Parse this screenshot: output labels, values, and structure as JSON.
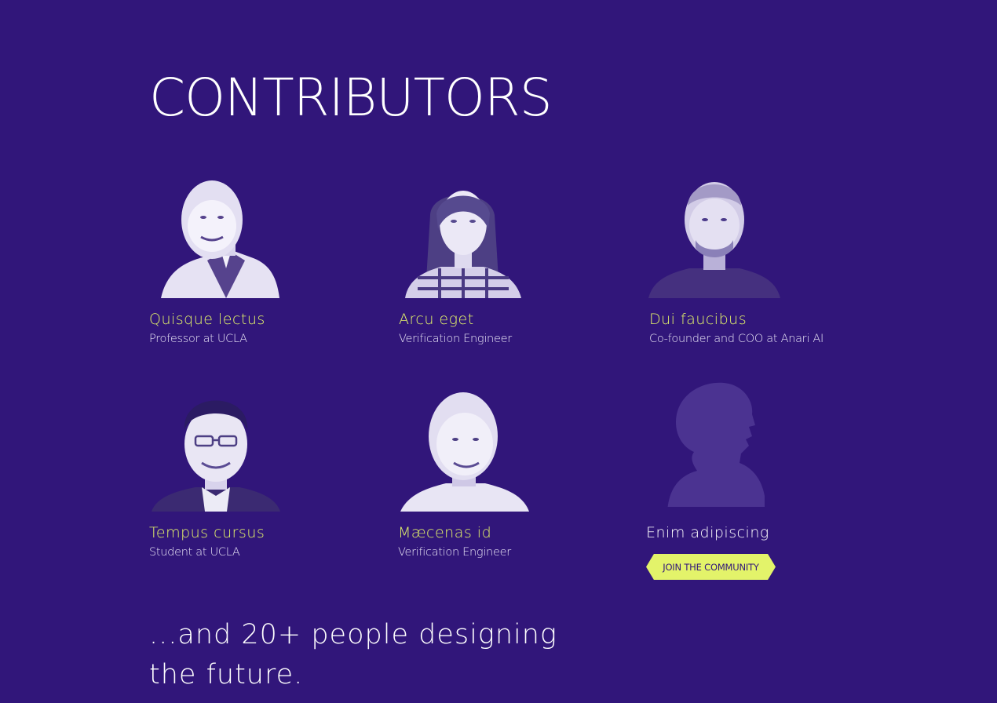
{
  "section": {
    "title": "CONTRIBUTORS"
  },
  "contributors": [
    {
      "name": "Quisque lectus",
      "role": "Professor at UCLA"
    },
    {
      "name": "Arcu eget",
      "role": "Verification Engineer"
    },
    {
      "name": "Dui faucibus",
      "role": "Co-founder and COO at Anari AI"
    },
    {
      "name": "Tempus cursus",
      "role": "Student at UCLA"
    },
    {
      "name": "Mæcenas id",
      "role": "Verification Engineer"
    }
  ],
  "placeholder": {
    "name": "Enim adipiscing",
    "cta_label": "JOIN THE COMMUNITY"
  },
  "tagline": {
    "line1": "...and 20+ people designing",
    "line2": "the future."
  },
  "colors": {
    "background": "#31167a",
    "accent": "#e3f36a",
    "text": "#ffffff"
  }
}
